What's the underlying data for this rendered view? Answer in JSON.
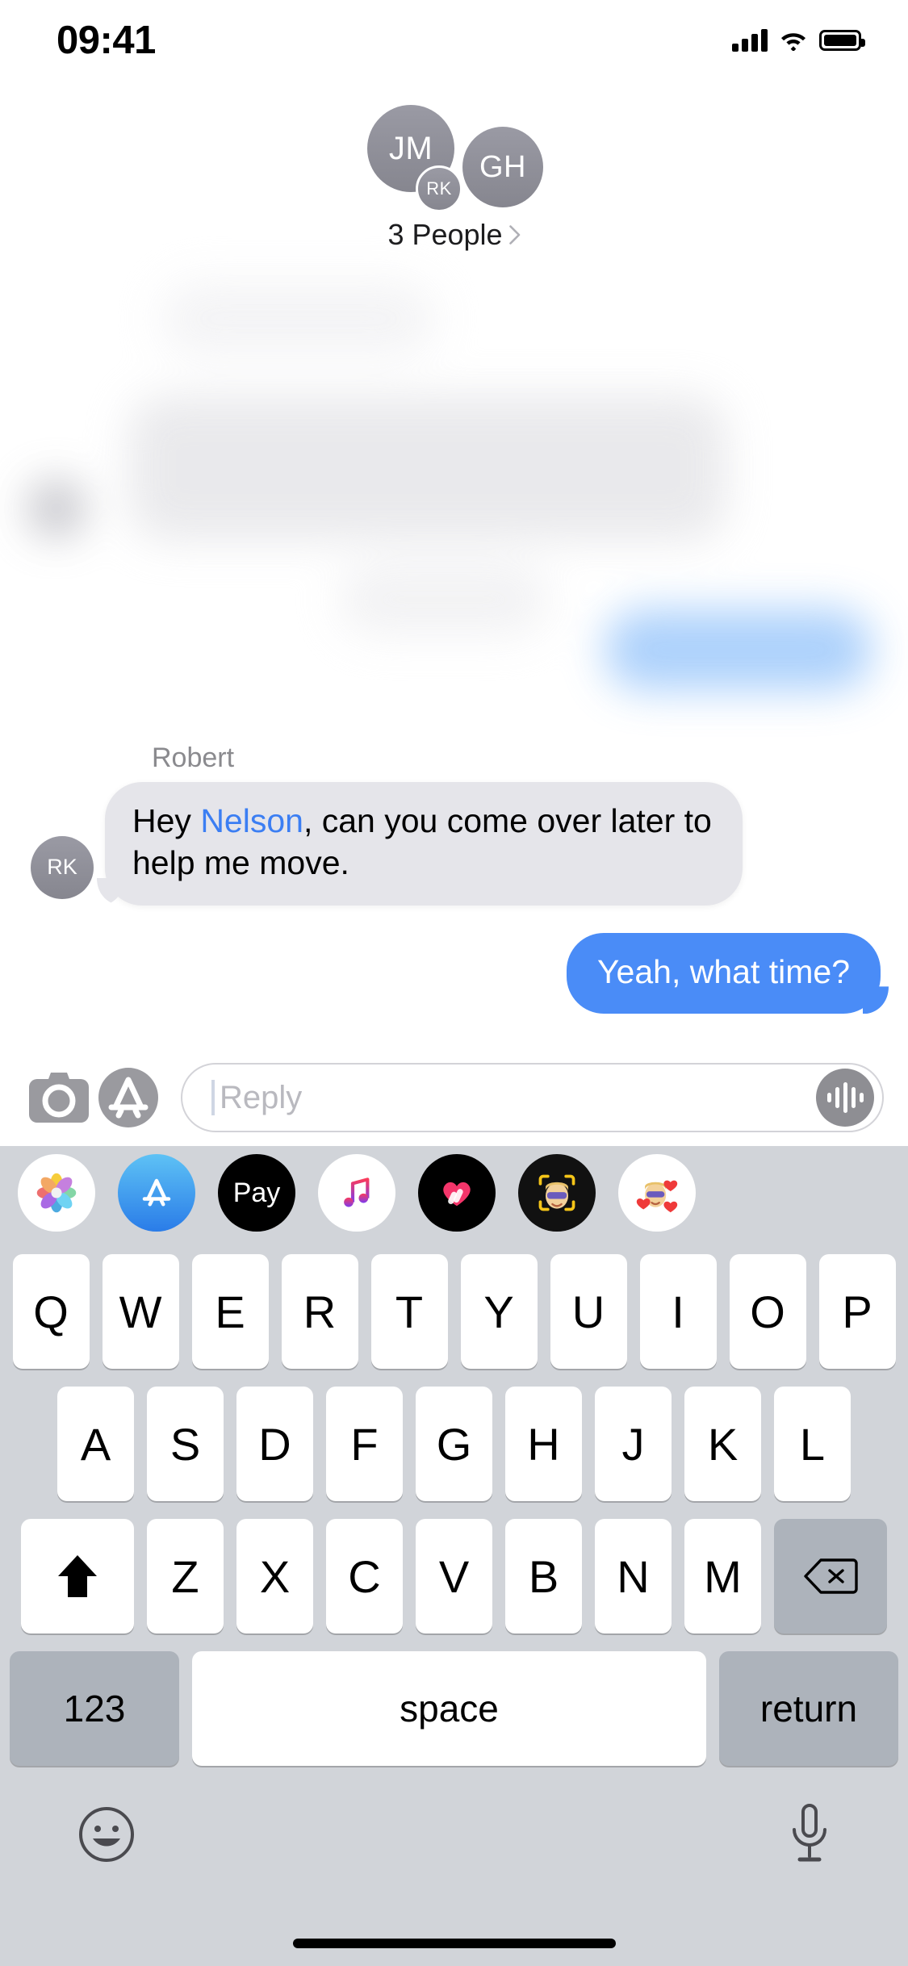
{
  "status_bar": {
    "time": "09:41",
    "signal_icon": "cellular-bars-icon",
    "wifi_icon": "wifi-icon",
    "battery_icon": "battery-full-icon"
  },
  "header": {
    "avatars": [
      {
        "initials": "JM",
        "name": "avatar-jm"
      },
      {
        "initials": "GH",
        "name": "avatar-gh"
      },
      {
        "initials": "RK",
        "name": "avatar-rk"
      }
    ],
    "participants_label": "3 People",
    "disclosure_icon": "chevron-right-icon"
  },
  "conversation": {
    "incoming": {
      "sender": "Robert",
      "avatar_initials": "RK",
      "text_before": "Hey ",
      "mention": "Nelson",
      "text_after": ", can you come over later to help me move."
    },
    "outgoing": {
      "text": "Yeah, what time?"
    }
  },
  "input_bar": {
    "camera_icon": "camera-icon",
    "appstore_icon": "app-store-icon",
    "placeholder": "Reply",
    "value": "",
    "audio_icon": "audio-waveform-icon"
  },
  "app_strip": [
    {
      "label": "Photos",
      "name": "app-photos"
    },
    {
      "label": "App Store",
      "name": "app-appstore"
    },
    {
      "label": "Pay",
      "name": "app-apple-pay"
    },
    {
      "label": "Music",
      "name": "app-music"
    },
    {
      "label": "Digital Touch",
      "name": "app-digital-touch"
    },
    {
      "label": "Memoji",
      "name": "app-memoji"
    },
    {
      "label": "Memoji Stickers",
      "name": "app-memoji-stickers"
    }
  ],
  "keyboard": {
    "row1": [
      "Q",
      "W",
      "E",
      "R",
      "T",
      "Y",
      "U",
      "I",
      "O",
      "P"
    ],
    "row2": [
      "A",
      "S",
      "D",
      "F",
      "G",
      "H",
      "J",
      "K",
      "L"
    ],
    "row3": [
      "Z",
      "X",
      "C",
      "V",
      "B",
      "N",
      "M"
    ],
    "shift_icon": "shift-icon",
    "delete_icon": "delete-backspace-icon",
    "numbers_label": "123",
    "space_label": "space",
    "return_label": "return",
    "emoji_icon": "emoji-smiley-icon",
    "dictation_icon": "microphone-icon"
  },
  "colors": {
    "imessage_blue": "#4a8cf7",
    "incoming_gray": "#e5e5ea",
    "mention_blue": "#3b7ef3",
    "keyboard_bg": "#d1d4d9",
    "key_dark": "#adb3bb",
    "avatar_gray": "#8e8e99"
  }
}
